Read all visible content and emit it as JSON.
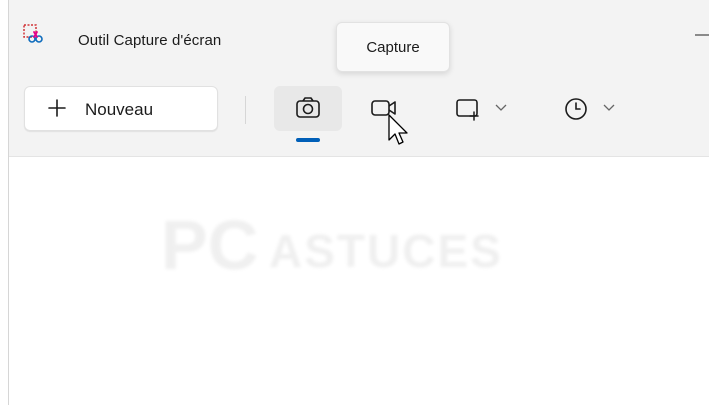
{
  "window": {
    "title": "Outil Capture d'écran",
    "app_icon": "snipping-tool-icon",
    "minimize_glyph": "—"
  },
  "toolbar": {
    "new_button_label": "Nouveau",
    "new_button_icon": "plus-icon",
    "capture_modes": [
      {
        "name": "photo",
        "icon": "camera-icon",
        "selected": true
      },
      {
        "name": "video",
        "icon": "video-camera-icon",
        "selected": false
      }
    ],
    "shape_dropdown_icon": "rectangle-snip-icon",
    "delay_dropdown_icon": "clock-icon"
  },
  "tooltip": {
    "text": "Capture"
  },
  "watermark": {
    "pc": "PC",
    "rest": "ASTUCES"
  },
  "colors": {
    "accent": "#005fb8",
    "window_bg": "#f3f3f3",
    "content_bg": "#ffffff"
  }
}
